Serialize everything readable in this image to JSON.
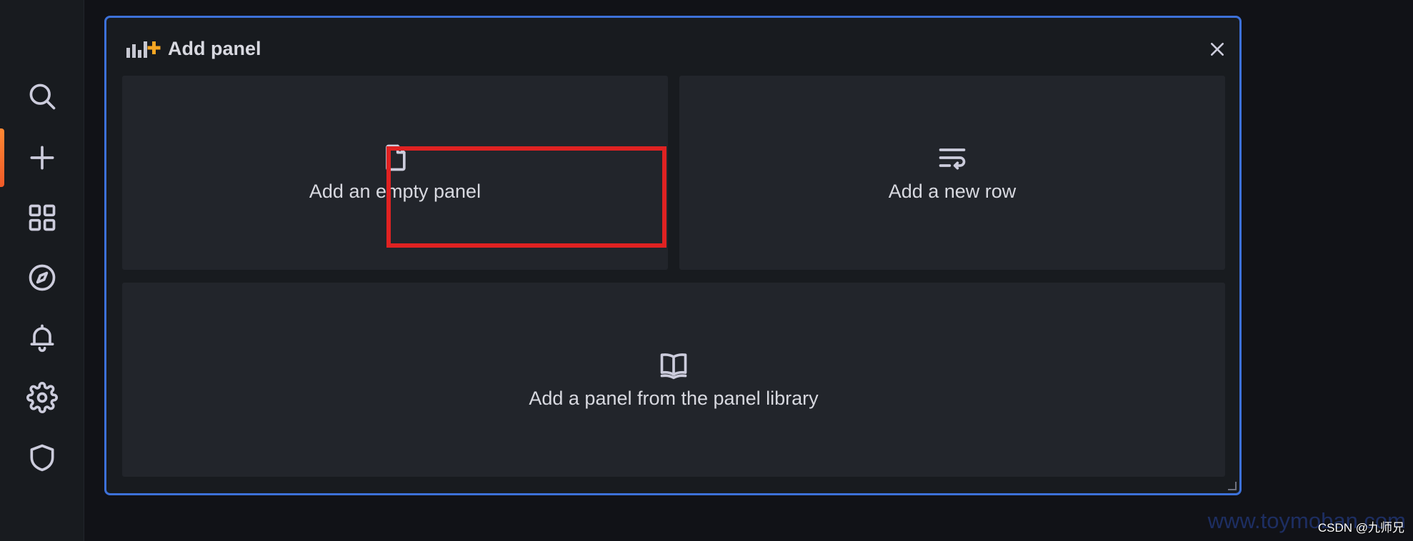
{
  "sidebar": {
    "items": [
      {
        "name": "search",
        "icon": "search-icon"
      },
      {
        "name": "create",
        "icon": "plus-icon",
        "active": true
      },
      {
        "name": "dashboards",
        "icon": "apps-icon"
      },
      {
        "name": "explore",
        "icon": "compass-icon"
      },
      {
        "name": "alerting",
        "icon": "bell-icon"
      },
      {
        "name": "configuration",
        "icon": "gear-icon"
      },
      {
        "name": "server-admin",
        "icon": "shield-icon"
      }
    ],
    "active_color": "#ff7a2f"
  },
  "add_panel": {
    "title": "Add panel",
    "title_icon": "add-panel-icon",
    "close_icon": "close-icon",
    "border_color": "#3d71d9",
    "options": {
      "empty_panel": {
        "label": "Add an empty panel",
        "icon": "file-icon"
      },
      "new_row": {
        "label": "Add a new row",
        "icon": "wrap-text-icon"
      },
      "library_panel": {
        "label": "Add a panel from the panel library",
        "icon": "book-icon"
      }
    },
    "highlight_color": "#e02222"
  },
  "watermark": {
    "text": "CSDN @九师兄",
    "faded_text": "www.toymoban.com"
  }
}
